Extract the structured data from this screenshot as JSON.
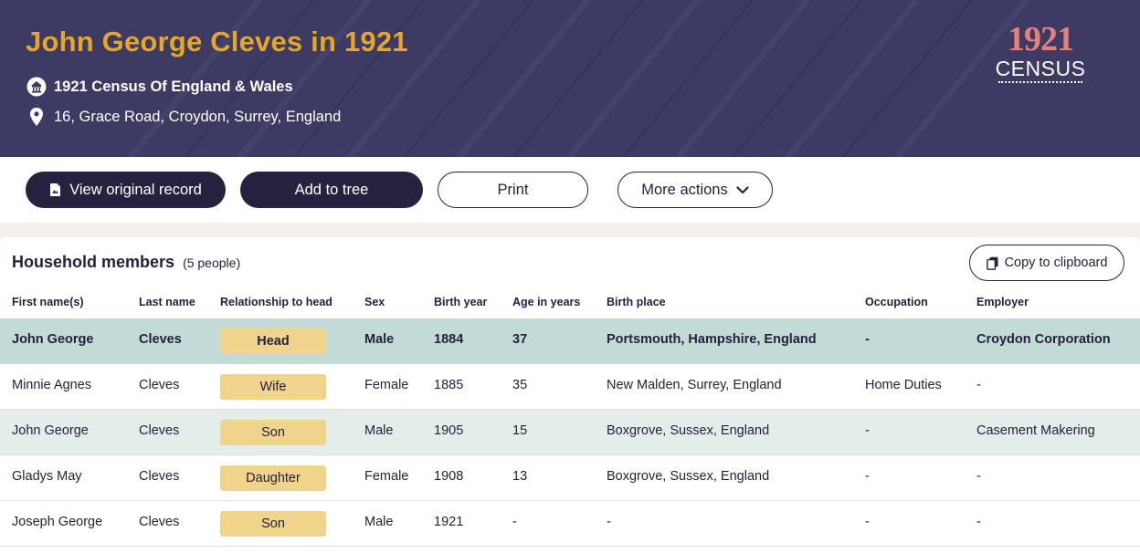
{
  "header": {
    "title": "John George Cleves in 1921",
    "collection": "1921 Census Of England & Wales",
    "address": "16, Grace Road, Croydon, Surrey, England",
    "logo_year": "1921",
    "logo_word": "CENSUS"
  },
  "actions": {
    "view_original": "View original record",
    "add_to_tree": "Add to tree",
    "print": "Print",
    "more_actions": "More actions"
  },
  "household": {
    "title": "Household members",
    "count": "(5 people)",
    "copy_label": "Copy to clipboard",
    "columns": [
      "First name(s)",
      "Last name",
      "Relationship to head",
      "Sex",
      "Birth year",
      "Age in years",
      "Birth place",
      "Occupation",
      "Employer"
    ],
    "rows": [
      {
        "first": "John George",
        "last": "Cleves",
        "relationship": "Head",
        "sex": "Male",
        "birth_year": "1884",
        "age": "37",
        "birth_place": "Portsmouth, Hampshire, England",
        "occupation": "-",
        "employer": "Croydon Corporation"
      },
      {
        "first": "Minnie Agnes",
        "last": "Cleves",
        "relationship": "Wife",
        "sex": "Female",
        "birth_year": "1885",
        "age": "35",
        "birth_place": "New Malden, Surrey, England",
        "occupation": "Home Duties",
        "employer": "-"
      },
      {
        "first": "John George",
        "last": "Cleves",
        "relationship": "Son",
        "sex": "Male",
        "birth_year": "1905",
        "age": "15",
        "birth_place": "Boxgrove, Sussex, England",
        "occupation": "-",
        "employer": "Casement Makering"
      },
      {
        "first": "Gladys May",
        "last": "Cleves",
        "relationship": "Daughter",
        "sex": "Female",
        "birth_year": "1908",
        "age": "13",
        "birth_place": "Boxgrove, Sussex, England",
        "occupation": "-",
        "employer": "-"
      },
      {
        "first": "Joseph George",
        "last": "Cleves",
        "relationship": "Son",
        "sex": "Male",
        "birth_year": "1921",
        "age": "-",
        "birth_place": "-",
        "occupation": "-",
        "employer": "-"
      }
    ]
  },
  "colors": {
    "banner_bg": "#3d3a63",
    "title_gold": "#e6a628",
    "button_dark": "#25223f",
    "row_highlight": "#c3dbd6",
    "row_alt": "#e3ede9",
    "relationship_badge": "#f0d48b",
    "logo_pink": "#e8807a"
  },
  "icons": {
    "collection": "building-icon",
    "address": "map-pin-icon",
    "view_original": "document-icon",
    "more_actions": "chevron-down-icon",
    "copy": "copy-icon"
  }
}
